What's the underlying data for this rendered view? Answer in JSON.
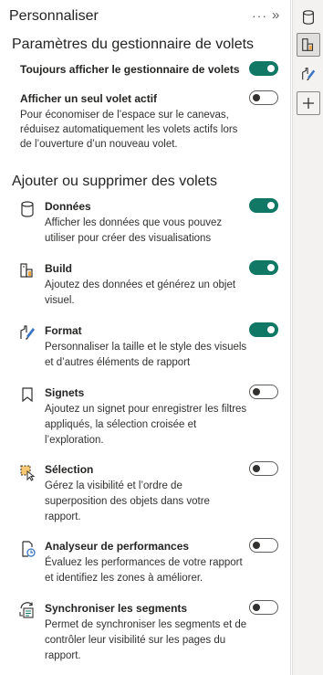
{
  "header": {
    "title": "Personnaliser",
    "more_label": "···",
    "collapse_label": "»"
  },
  "settings": {
    "title": "Paramètres du gestionnaire de volets",
    "always_show": {
      "label": "Toujours afficher le gestionnaire de volets",
      "on": true
    },
    "single_pane": {
      "label": "Afficher un seul volet actif",
      "on": false,
      "description": "Pour économiser de l’espace sur le canevas, réduisez automatiquement les volets actifs lors de l’ouverture d’un nouveau volet."
    }
  },
  "panes": {
    "title": "Ajouter ou supprimer des volets",
    "items": [
      {
        "icon": "cylinder-icon",
        "title": "Données",
        "on": true,
        "description": "Afficher les données que vous pouvez utiliser pour créer des visualisations"
      },
      {
        "icon": "build-icon",
        "title": "Build",
        "on": true,
        "description": "Ajoutez des données et générez un objet visuel."
      },
      {
        "icon": "format-brush-icon",
        "title": "Format",
        "on": true,
        "description": "Personnaliser la taille et le style des visuels et d’autres éléments de rapport"
      },
      {
        "icon": "bookmark-icon",
        "title": "Signets",
        "on": false,
        "description": "Ajoutez un signet pour enregistrer les filtres appliqués, la sélection croisée et l’exploration."
      },
      {
        "icon": "selection-icon",
        "title": "Sélection",
        "on": false,
        "description": "Gérez la visibilité et l’ordre de superposition des objets dans votre rapport."
      },
      {
        "icon": "performance-analyzer-icon",
        "title": "Analyseur de performances",
        "on": false,
        "description": "Évaluez les performances de votre rapport et identifiez les zones à améliorer."
      },
      {
        "icon": "sync-slicers-icon",
        "title": "Synchroniser les segments",
        "on": false,
        "description": "Permet de synchroniser les segments et de contrôler leur visibilité sur les pages du rapport."
      }
    ]
  },
  "rail": {
    "buttons": [
      {
        "icon": "data-icon"
      },
      {
        "icon": "build-icon",
        "active": true
      },
      {
        "icon": "format-brush-icon"
      },
      {
        "icon": "plus-icon"
      }
    ]
  },
  "colors": {
    "toggle_on": "#117865",
    "accent_orange": "#f2a33a"
  }
}
